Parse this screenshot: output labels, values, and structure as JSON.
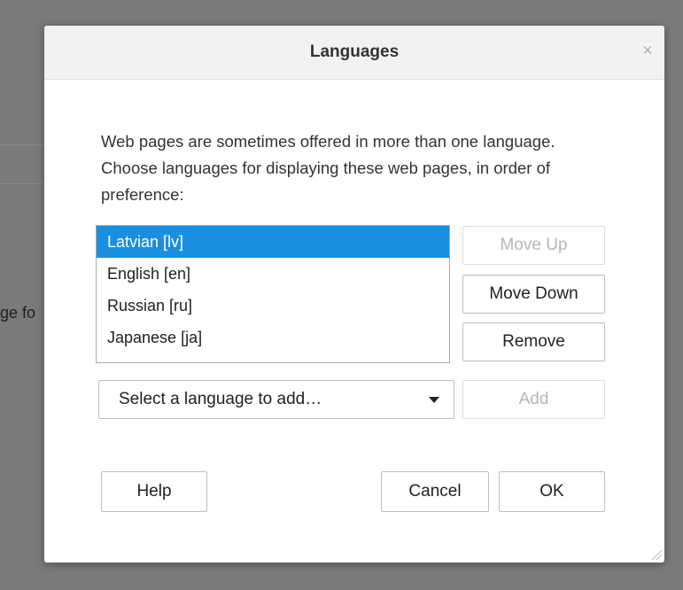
{
  "background": {
    "partial_text": "ge fo"
  },
  "dialog": {
    "title": "Languages",
    "close_glyph": "×",
    "description": "Web pages are sometimes offered in more than one language. Choose languages for displaying these web pages, in order of preference:",
    "languages": [
      {
        "label": "Latvian  [lv]",
        "selected": true
      },
      {
        "label": "English  [en]",
        "selected": false
      },
      {
        "label": "Russian  [ru]",
        "selected": false
      },
      {
        "label": "Japanese  [ja]",
        "selected": false
      }
    ],
    "buttons": {
      "move_up": "Move Up",
      "move_down": "Move Down",
      "remove": "Remove",
      "add": "Add",
      "help": "Help",
      "cancel": "Cancel",
      "ok": "OK"
    },
    "select": {
      "placeholder": "Select a language to add…"
    }
  },
  "colors": {
    "selection": "#1a8fe0",
    "disabled_text": "#b6b6b6"
  }
}
